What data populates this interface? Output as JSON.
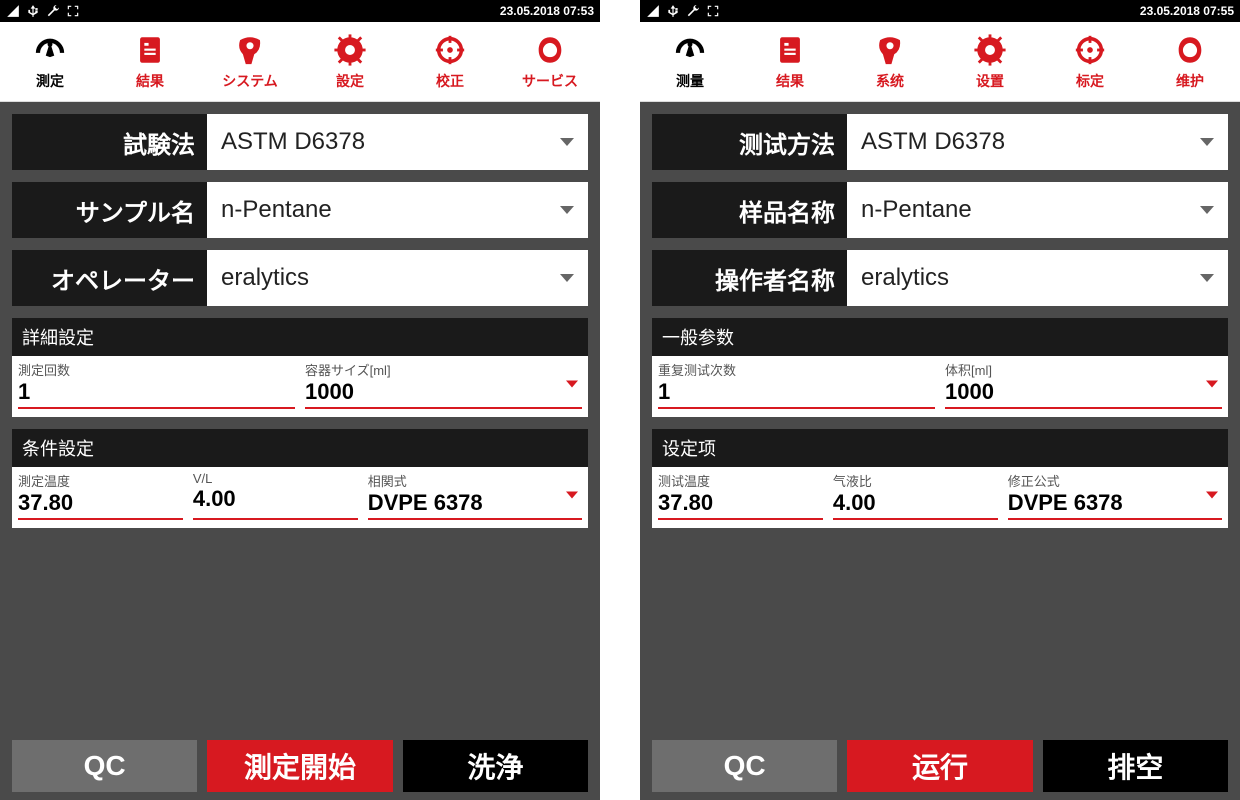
{
  "panels": [
    {
      "status_time": "23.05.2018 07:53",
      "tabs": [
        {
          "label": "測定",
          "active": true
        },
        {
          "label": "結果",
          "active": false
        },
        {
          "label": "システム",
          "active": false
        },
        {
          "label": "設定",
          "active": false
        },
        {
          "label": "校正",
          "active": false
        },
        {
          "label": "サービス",
          "active": false
        }
      ],
      "method_label": "試験法",
      "method_value": "ASTM D6378",
      "sample_label": "サンプル名",
      "sample_value": "n-Pentane",
      "operator_label": "オペレーター",
      "operator_value": "eralytics",
      "section1_header": "詳細設定",
      "s1_f1_label": "測定回数",
      "s1_f1_value": "1",
      "s1_f2_label": "容器サイズ[ml]",
      "s1_f2_value": "1000",
      "section2_header": "条件設定",
      "s2_f1_label": "測定温度",
      "s2_f1_value": "37.80",
      "s2_f2_label": "V/L",
      "s2_f2_value": "4.00",
      "s2_f3_label": "相関式",
      "s2_f3_value": "DVPE 6378",
      "btn_qc": "QC",
      "btn_run": "測定開始",
      "btn_rinse": "洗浄"
    },
    {
      "status_time": "23.05.2018 07:55",
      "tabs": [
        {
          "label": "测量",
          "active": true
        },
        {
          "label": "结果",
          "active": false
        },
        {
          "label": "系统",
          "active": false
        },
        {
          "label": "设置",
          "active": false
        },
        {
          "label": "标定",
          "active": false
        },
        {
          "label": "维护",
          "active": false
        }
      ],
      "method_label": "测试方法",
      "method_value": "ASTM D6378",
      "sample_label": "样品名称",
      "sample_value": "n-Pentane",
      "operator_label": "操作者名称",
      "operator_value": "eralytics",
      "section1_header": "一般参数",
      "s1_f1_label": "重复测试次数",
      "s1_f1_value": "1",
      "s1_f2_label": "体积[ml]",
      "s1_f2_value": "1000",
      "section2_header": "设定项",
      "s2_f1_label": "测试温度",
      "s2_f1_value": "37.80",
      "s2_f2_label": "气液比",
      "s2_f2_value": "4.00",
      "s2_f3_label": "修正公式",
      "s2_f3_value": "DVPE 6378",
      "btn_qc": "QC",
      "btn_run": "运行",
      "btn_rinse": "排空"
    }
  ],
  "icons": {
    "tab_names": [
      "gauge-icon",
      "document-icon",
      "system-icon",
      "gear-icon",
      "target-icon",
      "service-icon"
    ]
  }
}
